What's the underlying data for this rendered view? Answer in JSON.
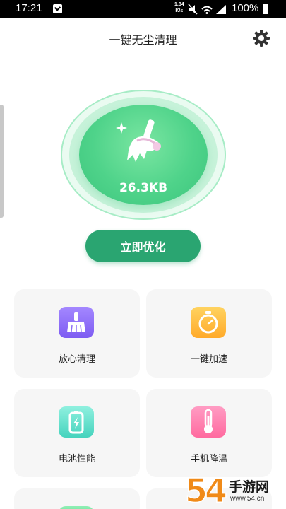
{
  "status_bar": {
    "time": "17:21",
    "net_speed_value": "1.84",
    "net_speed_unit": "K/s",
    "battery_percent": "100%"
  },
  "header": {
    "title": "一键无尘清理",
    "settings_icon": "gear-icon"
  },
  "hero": {
    "size_text": "26.3KB",
    "icon": "broom-icon",
    "accent_color": "#4fd38a"
  },
  "optimize_button": {
    "label": "立即优化",
    "color": "#2aa571"
  },
  "features": [
    {
      "label": "放心清理",
      "icon": "broom-icon",
      "color": "#7d5cf2"
    },
    {
      "label": "一键加速",
      "icon": "stopwatch-icon",
      "color": "#ffaa2a"
    },
    {
      "label": "电池性能",
      "icon": "battery-icon",
      "color": "#45d3bd"
    },
    {
      "label": "手机降温",
      "icon": "thermometer-icon",
      "color": "#ff6a9f"
    }
  ],
  "watermark": {
    "logo": "54",
    "title": "手游网",
    "url": "www.54.cn"
  }
}
